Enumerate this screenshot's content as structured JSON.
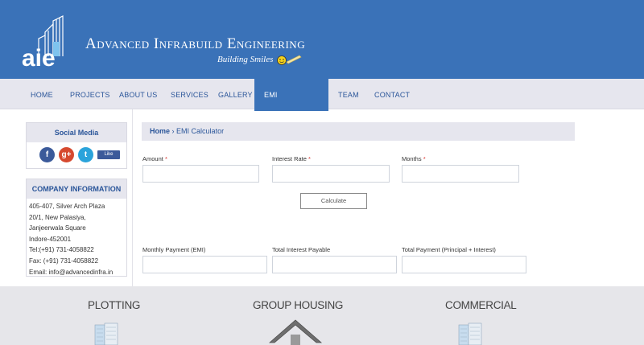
{
  "header": {
    "logo_text": "aie",
    "brand_name": "Advanced Infrabuild Engineering",
    "tagline": "Building Smiles"
  },
  "nav": {
    "items": [
      {
        "label": "HOME"
      },
      {
        "label": "PROJECTS"
      },
      {
        "label": "ABOUT US"
      },
      {
        "label": "SERVICES"
      },
      {
        "label": "GALLERY"
      },
      {
        "label": "EMI CALCULATOR",
        "active": true
      },
      {
        "label": "TEAM"
      },
      {
        "label": "CONTACT"
      }
    ]
  },
  "sidebar": {
    "social_title": "Social Media",
    "social_icons": [
      "facebook-icon",
      "google-plus-icon",
      "twitter-icon"
    ],
    "like_label": "Like",
    "company_title": "COMPANY INFORMATION",
    "company_lines": [
      "405-407, Silver Arch Plaza",
      "20/1, New Palasiya,",
      "Janjeerwala Square",
      "Indore-452001",
      "Tel:(+91) 731-4058822",
      "Fax: (+91) 731-4058822",
      "Email: info@advancedinfra.in"
    ]
  },
  "breadcrumb": {
    "home": "Home",
    "separator": "›",
    "current": "EMI Calculator"
  },
  "form": {
    "amount_label": "Amount",
    "interest_label": "Interest Rate",
    "months_label": "Months",
    "required_mark": "*",
    "amount_value": "",
    "interest_value": "",
    "months_value": "",
    "calculate_label": "Calculate",
    "monthly_payment_label": "Monthly Payment (EMI)",
    "total_interest_label": "Total Interest Payable",
    "total_payment_label": "Total Payment (Principal + Interest)",
    "monthly_payment_value": "",
    "total_interest_value": "",
    "total_payment_value": ""
  },
  "categories": [
    {
      "label": "PLOTTING"
    },
    {
      "label": "GROUP HOUSING"
    },
    {
      "label": "COMMERCIAL"
    }
  ],
  "colors": {
    "header_blue": "#3a72b8",
    "nav_bg": "#e6e6ee",
    "link_blue": "#2a5599",
    "required_red": "#d9322c"
  }
}
